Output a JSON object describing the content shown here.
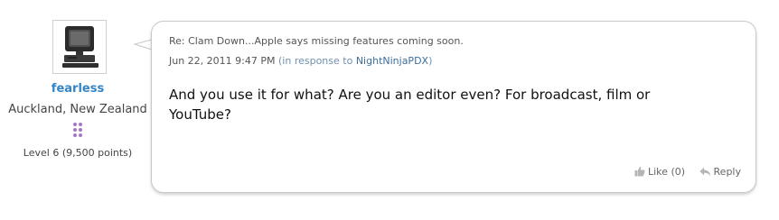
{
  "author": {
    "name": "fearless",
    "location": "Auckland, New Zealand",
    "level": "Level 6 (9,500 points)",
    "avatar_icon": "computer-icon",
    "level_badge_color": "#a778c9"
  },
  "post": {
    "subject": "Re: Clam Down...Apple says missing features coming soon.",
    "date": "Jun 22, 2011 9:47 PM",
    "in_response_prefix": "(in response to",
    "in_response_to": "NightNinjaPDX",
    "in_response_suffix": ")",
    "body": "And you use it for what? Are you an editor even? For broadcast, film or YouTube?"
  },
  "actions": {
    "like_label": "Like",
    "like_count": "(0)",
    "reply_label": "Reply",
    "like_icon": "thumbs-up-icon",
    "reply_icon": "reply-arrow-icon"
  },
  "colors": {
    "author_link": "#3385c6",
    "bubble_border": "#c8c8c8"
  }
}
